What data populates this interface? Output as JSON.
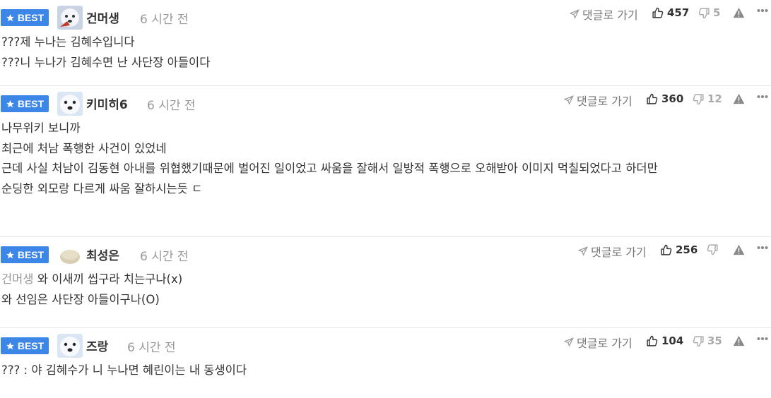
{
  "badge_label": "BEST",
  "icons": {
    "badge": "star-icon",
    "reply": "paper-plane-icon",
    "like": "thumbs-up-icon",
    "dislike": "thumbs-down-icon",
    "report": "warning-triangle-icon",
    "more": "more-dots-icon",
    "avatar": "cartoon-avatar"
  },
  "colors": {
    "badge": "#3b86e6",
    "text": "#333333",
    "muted": "#999999"
  },
  "comments": [
    {
      "nickname": "건머생",
      "time": "6 시간 전",
      "reply_label": "댓글로 가기",
      "likes": "457",
      "dislikes": "5",
      "lines": [
        "???제 누나는 김혜수입니다",
        "???니 누나가 김혜수면 난 사단장 아들이다"
      ]
    },
    {
      "nickname": "키미히6",
      "time": "6 시간 전",
      "reply_label": "댓글로 가기",
      "likes": "360",
      "dislikes": "12",
      "lines": [
        "나무위키 보니까",
        "최근에 처남 폭행한 사건이 있었네",
        "근데 사실 처남이 김동현 아내를 위협했기때문에 벌어진 일이었고 싸움을 잘해서 일방적 폭행으로 오해받아 이미지 먹칠되었다고 하더만",
        "순딩한 외모랑 다르게 싸움 잘하시는듯 ㄷ"
      ]
    },
    {
      "nickname": "최성은",
      "time": "6 시간 전",
      "reply_label": "댓글로 가기",
      "likes": "256",
      "dislikes": "",
      "mention": "건머생",
      "lines": [
        "와 이새끼 씹구라 치는구나(x)",
        "와 선임은 사단장 아들이구나(O)"
      ]
    },
    {
      "nickname": "즈랑",
      "time": "6 시간 전",
      "reply_label": "댓글로 가기",
      "likes": "104",
      "dislikes": "35",
      "lines": [
        "??? : 야 김혜수가 니 누나면 혜린이는 내 동생이다"
      ]
    }
  ]
}
